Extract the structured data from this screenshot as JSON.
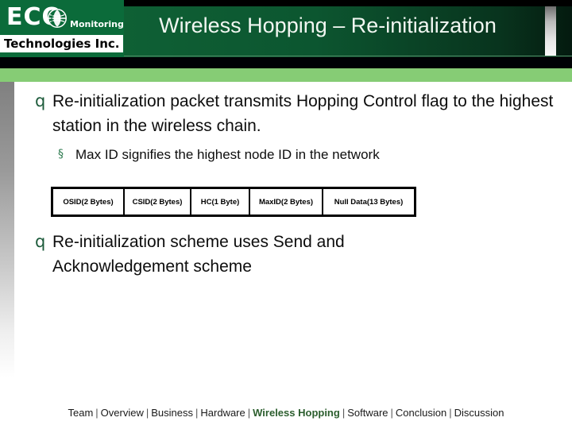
{
  "slide": {
    "title": "Wireless Hopping – Re-initialization",
    "logo": {
      "brand": "ECO",
      "tagline": "Monitoring",
      "company": "Technologies Inc.",
      "globe_icon": "globe-icon"
    },
    "colors": {
      "header_green": "#0b5530",
      "logo_green": "#0b6b3a",
      "accent_light_green": "#86cc75",
      "bullet_green": "#1d5b3b",
      "active_nav_green": "#2c5e2e"
    }
  },
  "content": {
    "bullets": [
      {
        "marker": "q",
        "text": "Re-initialization packet transmits Hopping Control flag to the highest station in the wireless chain."
      },
      {
        "marker": "q",
        "text": "Re-initialization scheme uses Send and Acknowledgement scheme"
      }
    ],
    "sub_bullet": {
      "marker": "§",
      "text": "Max ID signifies the highest node ID in the network"
    }
  },
  "packet_table": {
    "type": "table",
    "fields": [
      "OSID(2 Bytes)",
      "CSID(2 Bytes)",
      "HC(1 Byte)",
      "MaxID(2 Bytes)",
      "Null Data(13 Bytes)"
    ]
  },
  "footer": {
    "items": [
      {
        "label": "Team",
        "active": false
      },
      {
        "label": "Overview",
        "active": false
      },
      {
        "label": "Business",
        "active": false
      },
      {
        "label": "Hardware",
        "active": false
      },
      {
        "label": "Wireless Hopping",
        "active": true
      },
      {
        "label": "Software",
        "active": false
      },
      {
        "label": "Conclusion",
        "active": false
      },
      {
        "label": "Discussion",
        "active": false
      }
    ],
    "separator": "|"
  }
}
